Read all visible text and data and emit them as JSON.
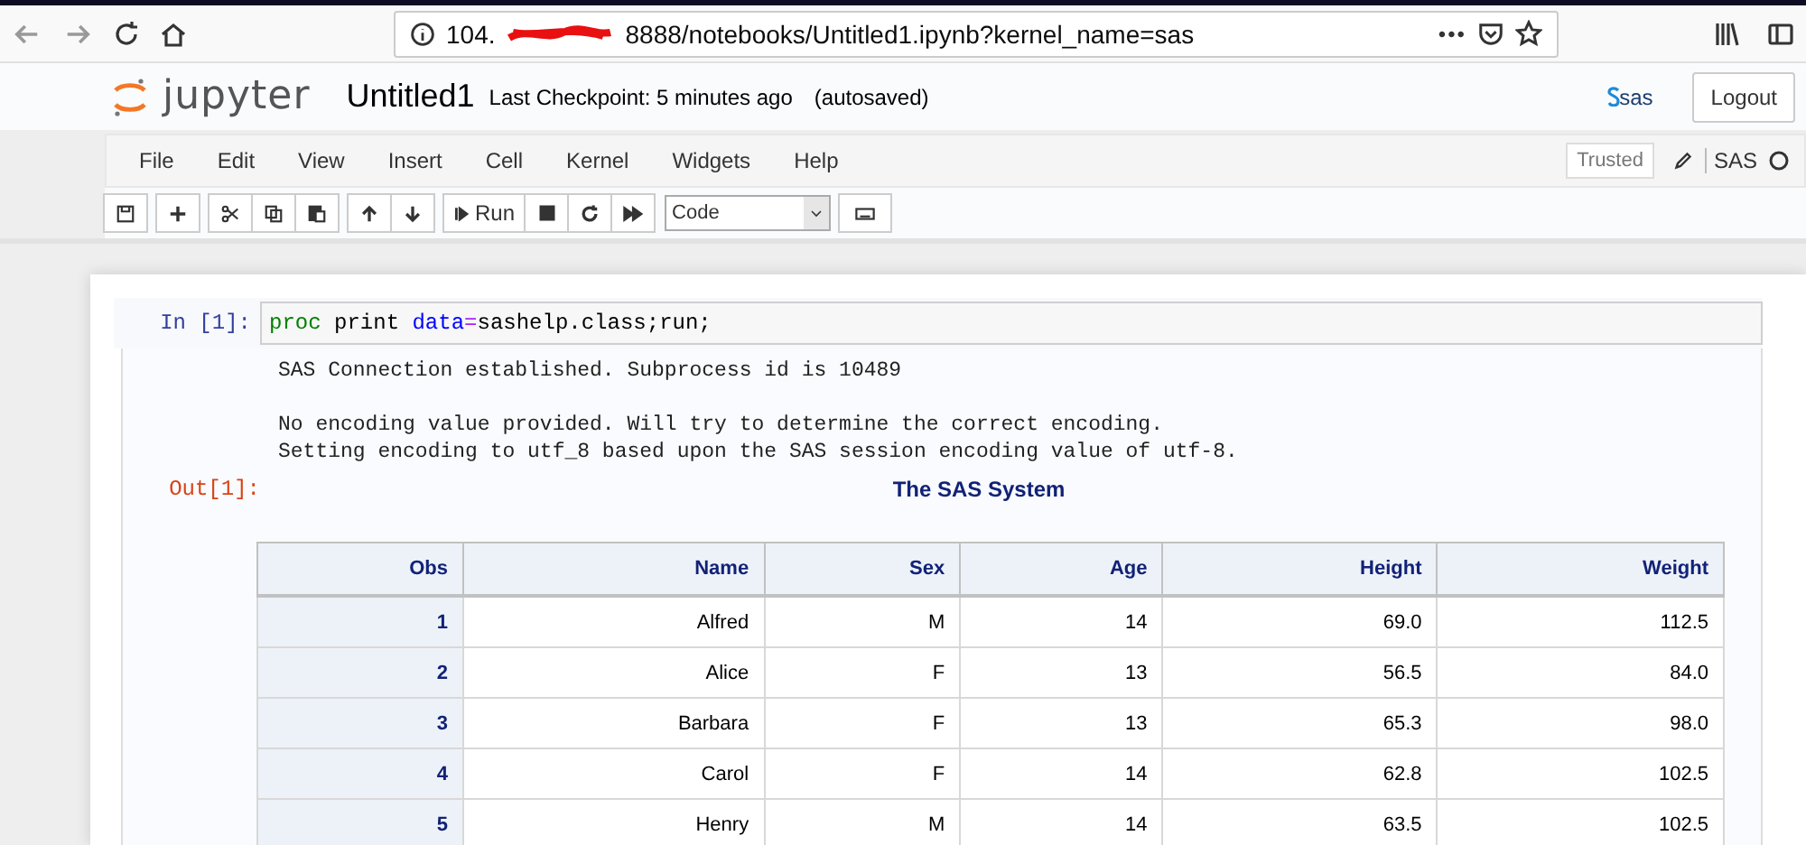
{
  "browser": {
    "url_start": "104.",
    "url_end": "8888/notebooks/Untitled1.ipynb?kernel_name=sas",
    "more": "•••"
  },
  "header": {
    "logo_text": "jupyter",
    "notebook_name": "Untitled1",
    "checkpoint": "Last Checkpoint: 5 minutes ago",
    "autosave": "(autosaved)",
    "brand": "sas",
    "logout": "Logout"
  },
  "menu": [
    "File",
    "Edit",
    "View",
    "Insert",
    "Cell",
    "Kernel",
    "Widgets",
    "Help"
  ],
  "menu_right": {
    "trusted": "Trusted",
    "kernel": "SAS"
  },
  "toolbar": {
    "run": "Run",
    "cell_type": "Code"
  },
  "cell": {
    "in_prompt": "In [1]:",
    "code": [
      {
        "kind": "keyword",
        "text": "proc"
      },
      {
        "kind": "plain",
        "text": " print "
      },
      {
        "kind": "builtin",
        "text": "data"
      },
      {
        "kind": "operator",
        "text": "="
      },
      {
        "kind": "plain",
        "text": "sashelp.class;run;"
      }
    ],
    "stream": [
      [
        "SAS Connection established. Subprocess id is 10489"
      ],
      [
        "No encoding value provided. Will try to determine the correct encoding.",
        "Setting encoding to utf_8 based upon the SAS session encoding value of utf-8."
      ]
    ],
    "out_prompt": "Out[1]:",
    "title": "The SAS System"
  },
  "table": {
    "columns": [
      "Obs",
      "Name",
      "Sex",
      "Age",
      "Height",
      "Weight"
    ],
    "rows": [
      [
        "1",
        "Alfred",
        "M",
        "14",
        "69.0",
        "112.5"
      ],
      [
        "2",
        "Alice",
        "F",
        "13",
        "56.5",
        "84.0"
      ],
      [
        "3",
        "Barbara",
        "F",
        "13",
        "65.3",
        "98.0"
      ],
      [
        "4",
        "Carol",
        "F",
        "14",
        "62.8",
        "102.5"
      ],
      [
        "5",
        "Henry",
        "M",
        "14",
        "63.5",
        "102.5"
      ]
    ]
  }
}
